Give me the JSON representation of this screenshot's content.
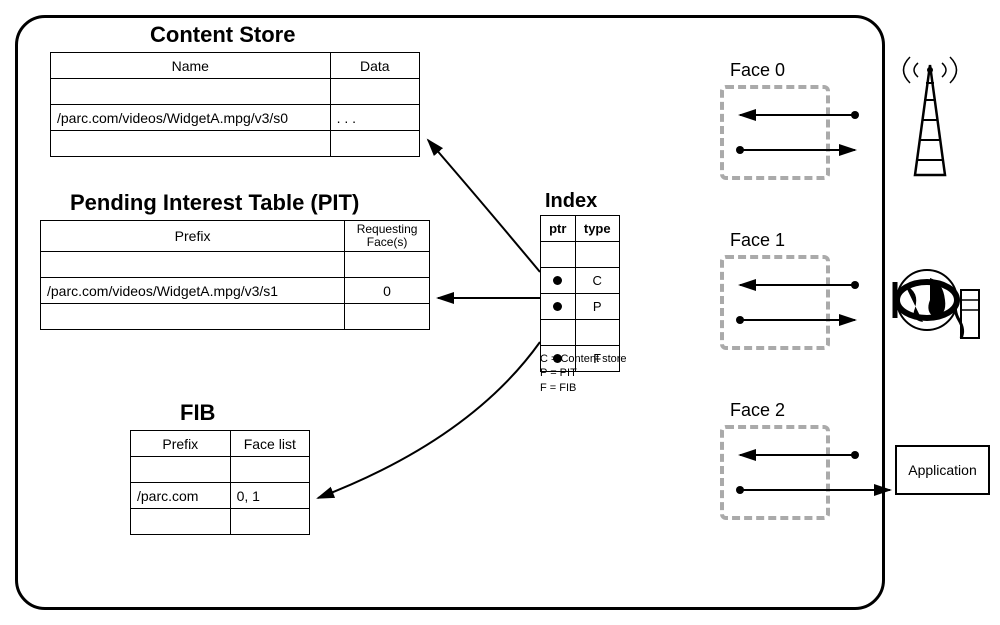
{
  "cs": {
    "title": "Content Store",
    "cols": {
      "name": "Name",
      "data": "Data"
    },
    "row": {
      "name": "/parc.com/videos/WidgetA.mpg/v3/s0",
      "data": ". . ."
    }
  },
  "pit": {
    "title": "Pending Interest Table (PIT)",
    "cols": {
      "prefix": "Prefix",
      "requesting": "Requesting Face(s)"
    },
    "row": {
      "prefix": "/parc.com/videos/WidgetA.mpg/v3/s1",
      "faces": "0"
    }
  },
  "fib": {
    "title": "FIB",
    "cols": {
      "prefix": "Prefix",
      "facelist": "Face list"
    },
    "row": {
      "prefix": "/parc.com",
      "facelist": "0, 1"
    }
  },
  "index": {
    "title": "Index",
    "cols": {
      "ptr": "ptr",
      "type": "type"
    },
    "rows": [
      {
        "type": "C"
      },
      {
        "type": "P"
      },
      {
        "type": "F"
      }
    ],
    "legend": {
      "c": "C = Content store",
      "p": "P = PIT",
      "f": "F = FIB"
    }
  },
  "faces": {
    "f0": "Face 0",
    "f1": "Face 1",
    "f2": "Face 2"
  },
  "app": {
    "label": "Application"
  }
}
